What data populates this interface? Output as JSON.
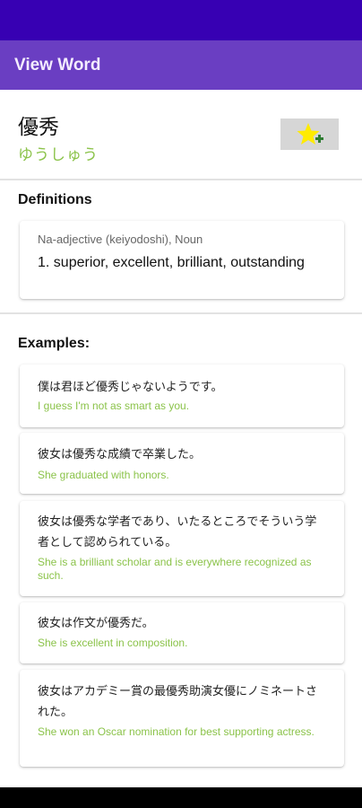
{
  "app": {
    "title": "View Word"
  },
  "word": {
    "kanji": "優秀",
    "reading": "ゆうしゅう"
  },
  "favorite_button": {
    "icon": "star-plus-icon",
    "star_color": "#ffeb00",
    "plus_color": "#2e7d32"
  },
  "definitions": {
    "heading": "Definitions",
    "items": [
      {
        "pos": "Na-adjective (keiyodoshi), Noun",
        "text": "1. superior, excellent, brilliant, outstanding"
      }
    ]
  },
  "examples": {
    "heading": "Examples:",
    "items": [
      {
        "jp": "僕は君ほど優秀じゃないようです。",
        "en": "I guess I'm not as smart as you."
      },
      {
        "jp": "彼女は優秀な成績で卒業した。",
        "en": "She graduated with honors."
      },
      {
        "jp": "彼女は優秀な学者であり、いたるところでそういう学者として認められている。",
        "en": "She is a brilliant scholar and is everywhere recognized as such."
      },
      {
        "jp": "彼女は作文が優秀だ。",
        "en": "She is excellent in composition."
      },
      {
        "jp": "彼女はアカデミー賞の最優秀助演女優にノミネートされた。",
        "en": "She won an Oscar nomination for best supporting actress."
      }
    ]
  },
  "colors": {
    "status_bar": "#3700b3",
    "app_bar": "#6a3ec2",
    "accent_green": "#8bc34a"
  }
}
